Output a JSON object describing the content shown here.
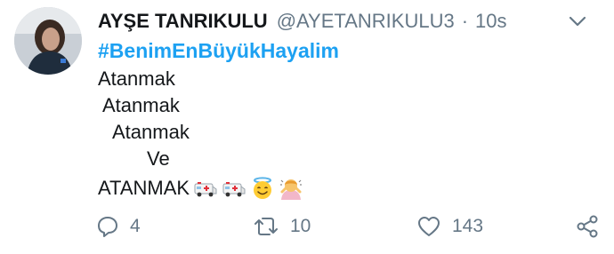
{
  "tweet": {
    "author_name": "AYŞE TANRIKULU",
    "handle": "@AYETANRIKULU3",
    "separator": "·",
    "time": "10s",
    "hashtag": "#BenimEnBüyükHayalim",
    "lines": [
      "Atanmak",
      "Atanmak",
      "Atanmak",
      "Ve",
      "ATANMAK"
    ],
    "emojis": [
      "ambulance-emoji",
      "ambulance-emoji",
      "smiling-face-with-halo-emoji",
      "person-bowing-emoji"
    ]
  },
  "actions": {
    "reply_count": "4",
    "retweet_count": "10",
    "like_count": "143"
  },
  "colors": {
    "link_blue": "#1da1f2",
    "muted_gray": "#657786",
    "text_dark": "#14171a"
  }
}
